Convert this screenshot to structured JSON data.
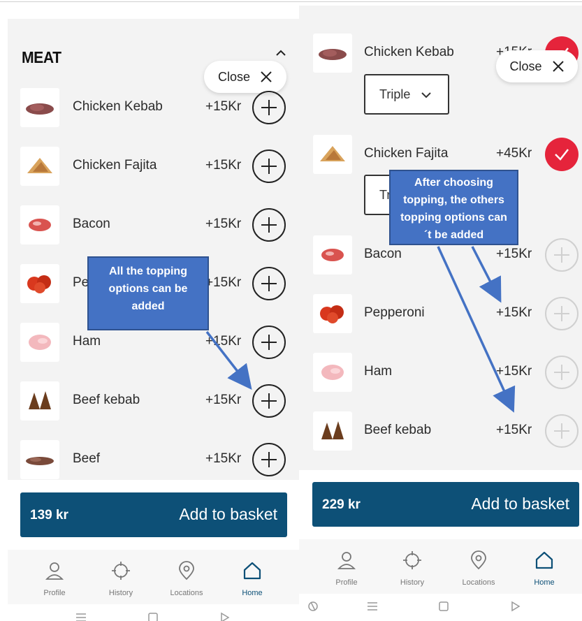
{
  "left_screen": {
    "section_title": "MEAT",
    "close_label": "Close",
    "items": [
      {
        "name": "Chicken Kebab",
        "price": "+15Kr"
      },
      {
        "name": "Chicken Fajita",
        "price": "+15Kr"
      },
      {
        "name": "Bacon",
        "price": "+15Kr"
      },
      {
        "name": "Pe",
        "price": "+15Kr"
      },
      {
        "name": "Ham",
        "price": "+15Kr"
      },
      {
        "name": "Beef kebab",
        "price": "+15Kr"
      },
      {
        "name": "Beef",
        "price": "+15Kr"
      }
    ],
    "basket": {
      "amount": "139 kr",
      "label": "Add to basket"
    },
    "callout": "All the topping options can be added",
    "tabs": [
      "Profile",
      "History",
      "Locations",
      "Home"
    ]
  },
  "right_screen": {
    "close_label": "Close",
    "items": [
      {
        "name": "Chicken Kebab",
        "price": "+15Kr",
        "selected": true,
        "quantity": "Triple"
      },
      {
        "name": "Chicken Fajita",
        "price": "+45Kr",
        "selected": true,
        "quantity": "Tr"
      },
      {
        "name": "Bacon",
        "price": "+15Kr",
        "selected": false
      },
      {
        "name": "Pepperoni",
        "price": "+15Kr",
        "selected": false
      },
      {
        "name": "Ham",
        "price": "+15Kr",
        "selected": false
      },
      {
        "name": "Beef kebab",
        "price": "+15Kr",
        "selected": false
      }
    ],
    "basket": {
      "amount": "229 kr",
      "label": "Add to basket"
    },
    "callout": "After choosing topping, the others topping options can´t be added",
    "tabs": [
      "Profile",
      "History",
      "Locations",
      "Home"
    ]
  },
  "colors": {
    "brand": "#0d5077",
    "selected": "#e5243b",
    "callout": "#4472c4",
    "callout_border": "#2f528f",
    "background": "#f3f3f3"
  },
  "icons": [
    "chevron-up-icon",
    "close-icon",
    "plus-icon",
    "check-icon",
    "chevron-down-icon",
    "profile-icon",
    "history-icon",
    "location-icon",
    "home-icon",
    "menu-icon",
    "square-icon",
    "back-icon",
    "rotate-icon"
  ]
}
